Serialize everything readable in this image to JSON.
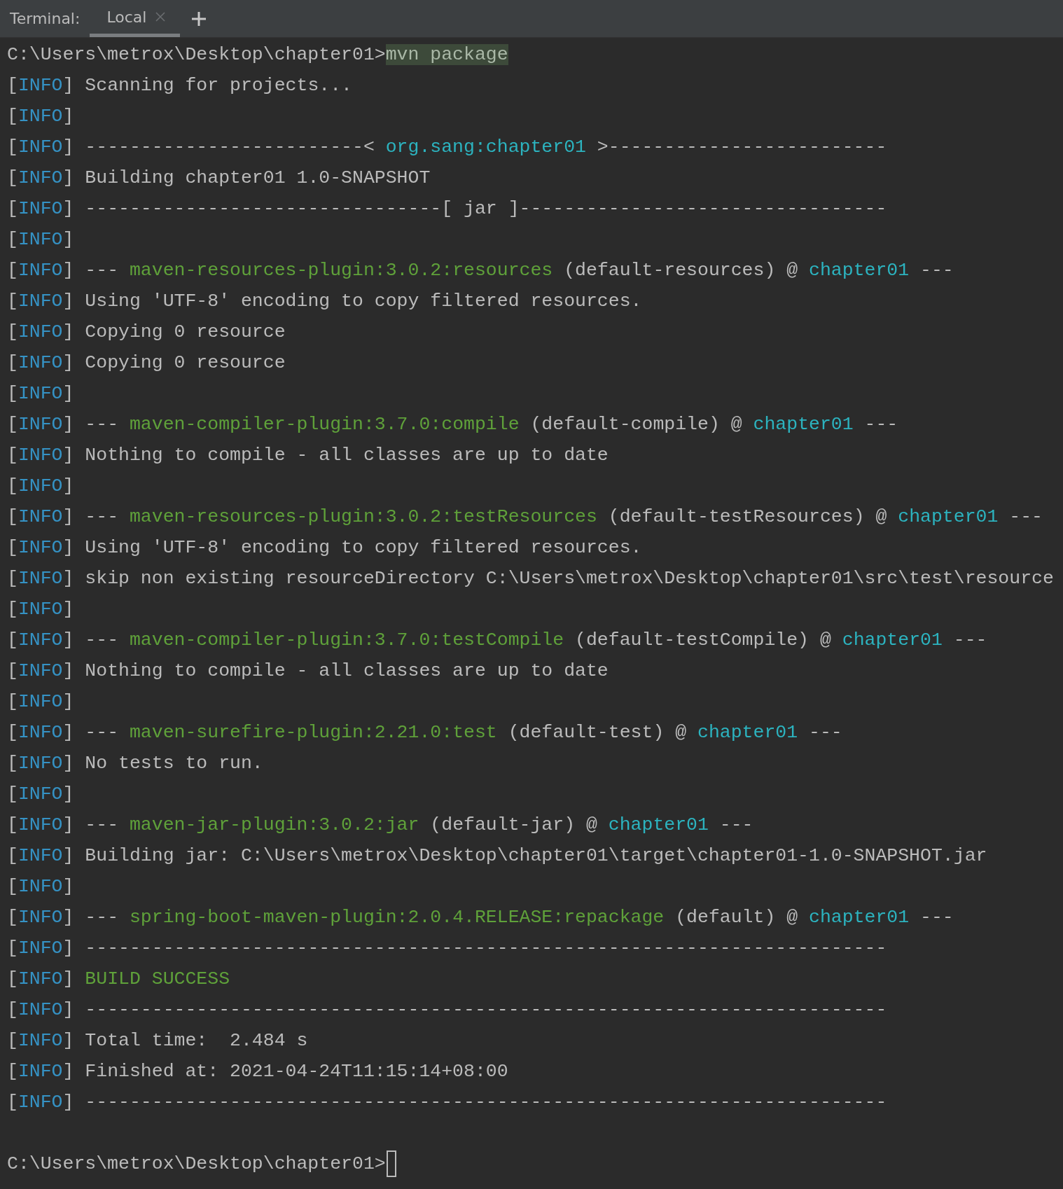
{
  "toolbar": {
    "title": "Terminal:",
    "tabs": [
      {
        "label": "Local",
        "selected": true,
        "closable": true
      }
    ]
  },
  "lines": [
    {
      "kind": "prompt",
      "path": "C:\\Users\\metrox\\Desktop\\chapter01>",
      "command": "mvn package"
    },
    {
      "kind": "info",
      "tag": "[INFO]",
      "segments": [
        {
          "text": "Scanning for projects...",
          "color": "#bbbbbb"
        }
      ]
    },
    {
      "kind": "info",
      "tag": "[INFO]"
    },
    {
      "kind": "info",
      "tag": "[INFO]",
      "segments": [
        {
          "text": "-------------------------< ",
          "color": "#bbbbbb"
        },
        {
          "text": "org.sang:chapter01",
          "color": "#2cb3bf"
        },
        {
          "text": " >-------------------------",
          "color": "#bbbbbb"
        }
      ]
    },
    {
      "kind": "info",
      "tag": "[INFO]",
      "segments": [
        {
          "text": "Building chapter01 1.0-SNAPSHOT",
          "color": "#bbbbbb"
        }
      ]
    },
    {
      "kind": "info",
      "tag": "[INFO]",
      "segments": [
        {
          "text": "--------------------------------[ jar ]---------------------------------",
          "color": "#bbbbbb"
        }
      ]
    },
    {
      "kind": "info",
      "tag": "[INFO]"
    },
    {
      "kind": "info",
      "tag": "[INFO]",
      "segments": [
        {
          "text": "--- ",
          "color": "#bbbbbb"
        },
        {
          "text": "maven-resources-plugin:3.0.2:resources",
          "color": "#5fa13a"
        },
        {
          "text": " (default-resources) @ ",
          "color": "#bbbbbb"
        },
        {
          "text": "chapter01",
          "color": "#2cb3bf"
        },
        {
          "text": " ---",
          "color": "#bbbbbb"
        }
      ]
    },
    {
      "kind": "info",
      "tag": "[INFO]",
      "segments": [
        {
          "text": "Using 'UTF-8' encoding to copy filtered resources.",
          "color": "#bbbbbb"
        }
      ]
    },
    {
      "kind": "info",
      "tag": "[INFO]",
      "segments": [
        {
          "text": "Copying 0 resource",
          "color": "#bbbbbb"
        }
      ]
    },
    {
      "kind": "info",
      "tag": "[INFO]",
      "segments": [
        {
          "text": "Copying 0 resource",
          "color": "#bbbbbb"
        }
      ]
    },
    {
      "kind": "info",
      "tag": "[INFO]"
    },
    {
      "kind": "info",
      "tag": "[INFO]",
      "segments": [
        {
          "text": "--- ",
          "color": "#bbbbbb"
        },
        {
          "text": "maven-compiler-plugin:3.7.0:compile",
          "color": "#5fa13a"
        },
        {
          "text": " (default-compile) @ ",
          "color": "#bbbbbb"
        },
        {
          "text": "chapter01",
          "color": "#2cb3bf"
        },
        {
          "text": " ---",
          "color": "#bbbbbb"
        }
      ]
    },
    {
      "kind": "info",
      "tag": "[INFO]",
      "segments": [
        {
          "text": "Nothing to compile - all classes are up to date",
          "color": "#bbbbbb"
        }
      ]
    },
    {
      "kind": "info",
      "tag": "[INFO]"
    },
    {
      "kind": "info",
      "tag": "[INFO]",
      "segments": [
        {
          "text": "--- ",
          "color": "#bbbbbb"
        },
        {
          "text": "maven-resources-plugin:3.0.2:testResources",
          "color": "#5fa13a"
        },
        {
          "text": " (default-testResources) @ ",
          "color": "#bbbbbb"
        },
        {
          "text": "chapter01",
          "color": "#2cb3bf"
        },
        {
          "text": " ---",
          "color": "#bbbbbb"
        }
      ]
    },
    {
      "kind": "info",
      "tag": "[INFO]",
      "segments": [
        {
          "text": "Using 'UTF-8' encoding to copy filtered resources.",
          "color": "#bbbbbb"
        }
      ]
    },
    {
      "kind": "info",
      "tag": "[INFO]",
      "segments": [
        {
          "text": "skip non existing resourceDirectory C:\\Users\\metrox\\Desktop\\chapter01\\src\\test\\resource",
          "color": "#bbbbbb"
        }
      ]
    },
    {
      "kind": "info",
      "tag": "[INFO]"
    },
    {
      "kind": "info",
      "tag": "[INFO]",
      "segments": [
        {
          "text": "--- ",
          "color": "#bbbbbb"
        },
        {
          "text": "maven-compiler-plugin:3.7.0:testCompile",
          "color": "#5fa13a"
        },
        {
          "text": " (default-testCompile) @ ",
          "color": "#bbbbbb"
        },
        {
          "text": "chapter01",
          "color": "#2cb3bf"
        },
        {
          "text": " ---",
          "color": "#bbbbbb"
        }
      ]
    },
    {
      "kind": "info",
      "tag": "[INFO]",
      "segments": [
        {
          "text": "Nothing to compile - all classes are up to date",
          "color": "#bbbbbb"
        }
      ]
    },
    {
      "kind": "info",
      "tag": "[INFO]"
    },
    {
      "kind": "info",
      "tag": "[INFO]",
      "segments": [
        {
          "text": "--- ",
          "color": "#bbbbbb"
        },
        {
          "text": "maven-surefire-plugin:2.21.0:test",
          "color": "#5fa13a"
        },
        {
          "text": " (default-test) @ ",
          "color": "#bbbbbb"
        },
        {
          "text": "chapter01",
          "color": "#2cb3bf"
        },
        {
          "text": " ---",
          "color": "#bbbbbb"
        }
      ]
    },
    {
      "kind": "info",
      "tag": "[INFO]",
      "segments": [
        {
          "text": "No tests to run.",
          "color": "#bbbbbb"
        }
      ]
    },
    {
      "kind": "info",
      "tag": "[INFO]"
    },
    {
      "kind": "info",
      "tag": "[INFO]",
      "segments": [
        {
          "text": "--- ",
          "color": "#bbbbbb"
        },
        {
          "text": "maven-jar-plugin:3.0.2:jar",
          "color": "#5fa13a"
        },
        {
          "text": " (default-jar) @ ",
          "color": "#bbbbbb"
        },
        {
          "text": "chapter01",
          "color": "#2cb3bf"
        },
        {
          "text": " ---",
          "color": "#bbbbbb"
        }
      ]
    },
    {
      "kind": "info",
      "tag": "[INFO]",
      "segments": [
        {
          "text": "Building jar: C:\\Users\\metrox\\Desktop\\chapter01\\target\\chapter01-1.0-SNAPSHOT.jar",
          "color": "#bbbbbb"
        }
      ]
    },
    {
      "kind": "info",
      "tag": "[INFO]"
    },
    {
      "kind": "info",
      "tag": "[INFO]",
      "segments": [
        {
          "text": "--- ",
          "color": "#bbbbbb"
        },
        {
          "text": "spring-boot-maven-plugin:2.0.4.RELEASE:repackage",
          "color": "#5fa13a"
        },
        {
          "text": " (default) @ ",
          "color": "#bbbbbb"
        },
        {
          "text": "chapter01",
          "color": "#2cb3bf"
        },
        {
          "text": " ---",
          "color": "#bbbbbb"
        }
      ]
    },
    {
      "kind": "info",
      "tag": "[INFO]",
      "segments": [
        {
          "text": "------------------------------------------------------------------------",
          "color": "#bbbbbb"
        }
      ]
    },
    {
      "kind": "info",
      "tag": "[INFO]",
      "segments": [
        {
          "text": "BUILD SUCCESS",
          "color": "#5fa13a"
        }
      ]
    },
    {
      "kind": "info",
      "tag": "[INFO]",
      "segments": [
        {
          "text": "------------------------------------------------------------------------",
          "color": "#bbbbbb"
        }
      ]
    },
    {
      "kind": "info",
      "tag": "[INFO]",
      "segments": [
        {
          "text": "Total time:  2.484 s",
          "color": "#bbbbbb"
        }
      ]
    },
    {
      "kind": "info",
      "tag": "[INFO]",
      "segments": [
        {
          "text": "Finished at: 2021-04-24T11:15:14+08:00",
          "color": "#bbbbbb"
        }
      ]
    },
    {
      "kind": "info",
      "tag": "[INFO]",
      "segments": [
        {
          "text": "------------------------------------------------------------------------",
          "color": "#bbbbbb"
        }
      ]
    },
    {
      "kind": "blank"
    },
    {
      "kind": "prompt",
      "path": "C:\\Users\\metrox\\Desktop\\chapter01>",
      "cursor": true
    }
  ]
}
